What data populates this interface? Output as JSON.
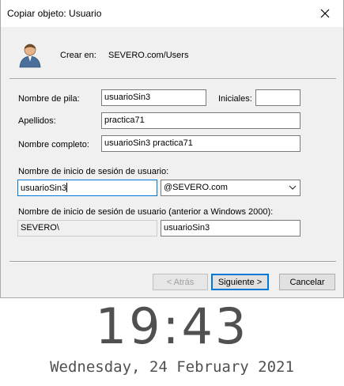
{
  "window": {
    "title": "Copiar objeto: Usuario",
    "close_glyph": "✕"
  },
  "header": {
    "icon": "user-icon",
    "create_in_label": "Crear en:",
    "create_in_value": "SEVERO.com/Users"
  },
  "form": {
    "first_name_label": "Nombre de pila:",
    "first_name_value": "usuarioSin3",
    "initials_label": "Iniciales:",
    "initials_value": "",
    "last_name_label": "Apellidos:",
    "last_name_value": "practica71",
    "full_name_label": "Nombre completo:",
    "full_name_value": "usuarioSin3 practica71",
    "logon_label": "Nombre de inicio de sesión de usuario:",
    "logon_value": "usuarioSin3",
    "domain_value": "@SEVERO.com",
    "legacy_label": "Nombre de inicio de sesión de usuario (anterior a Windows 2000):",
    "legacy_domain_value": "SEVERO\\",
    "legacy_user_value": "usuarioSin3"
  },
  "buttons": {
    "back": "< Atrás",
    "next": "Siguiente >",
    "cancel": "Cancelar"
  },
  "lockscreen": {
    "time": "19:43",
    "date": "Wednesday, 24 February 2021"
  },
  "colors": {
    "accent": "#0078d7",
    "dialog_bg": "#f0f0f0"
  }
}
